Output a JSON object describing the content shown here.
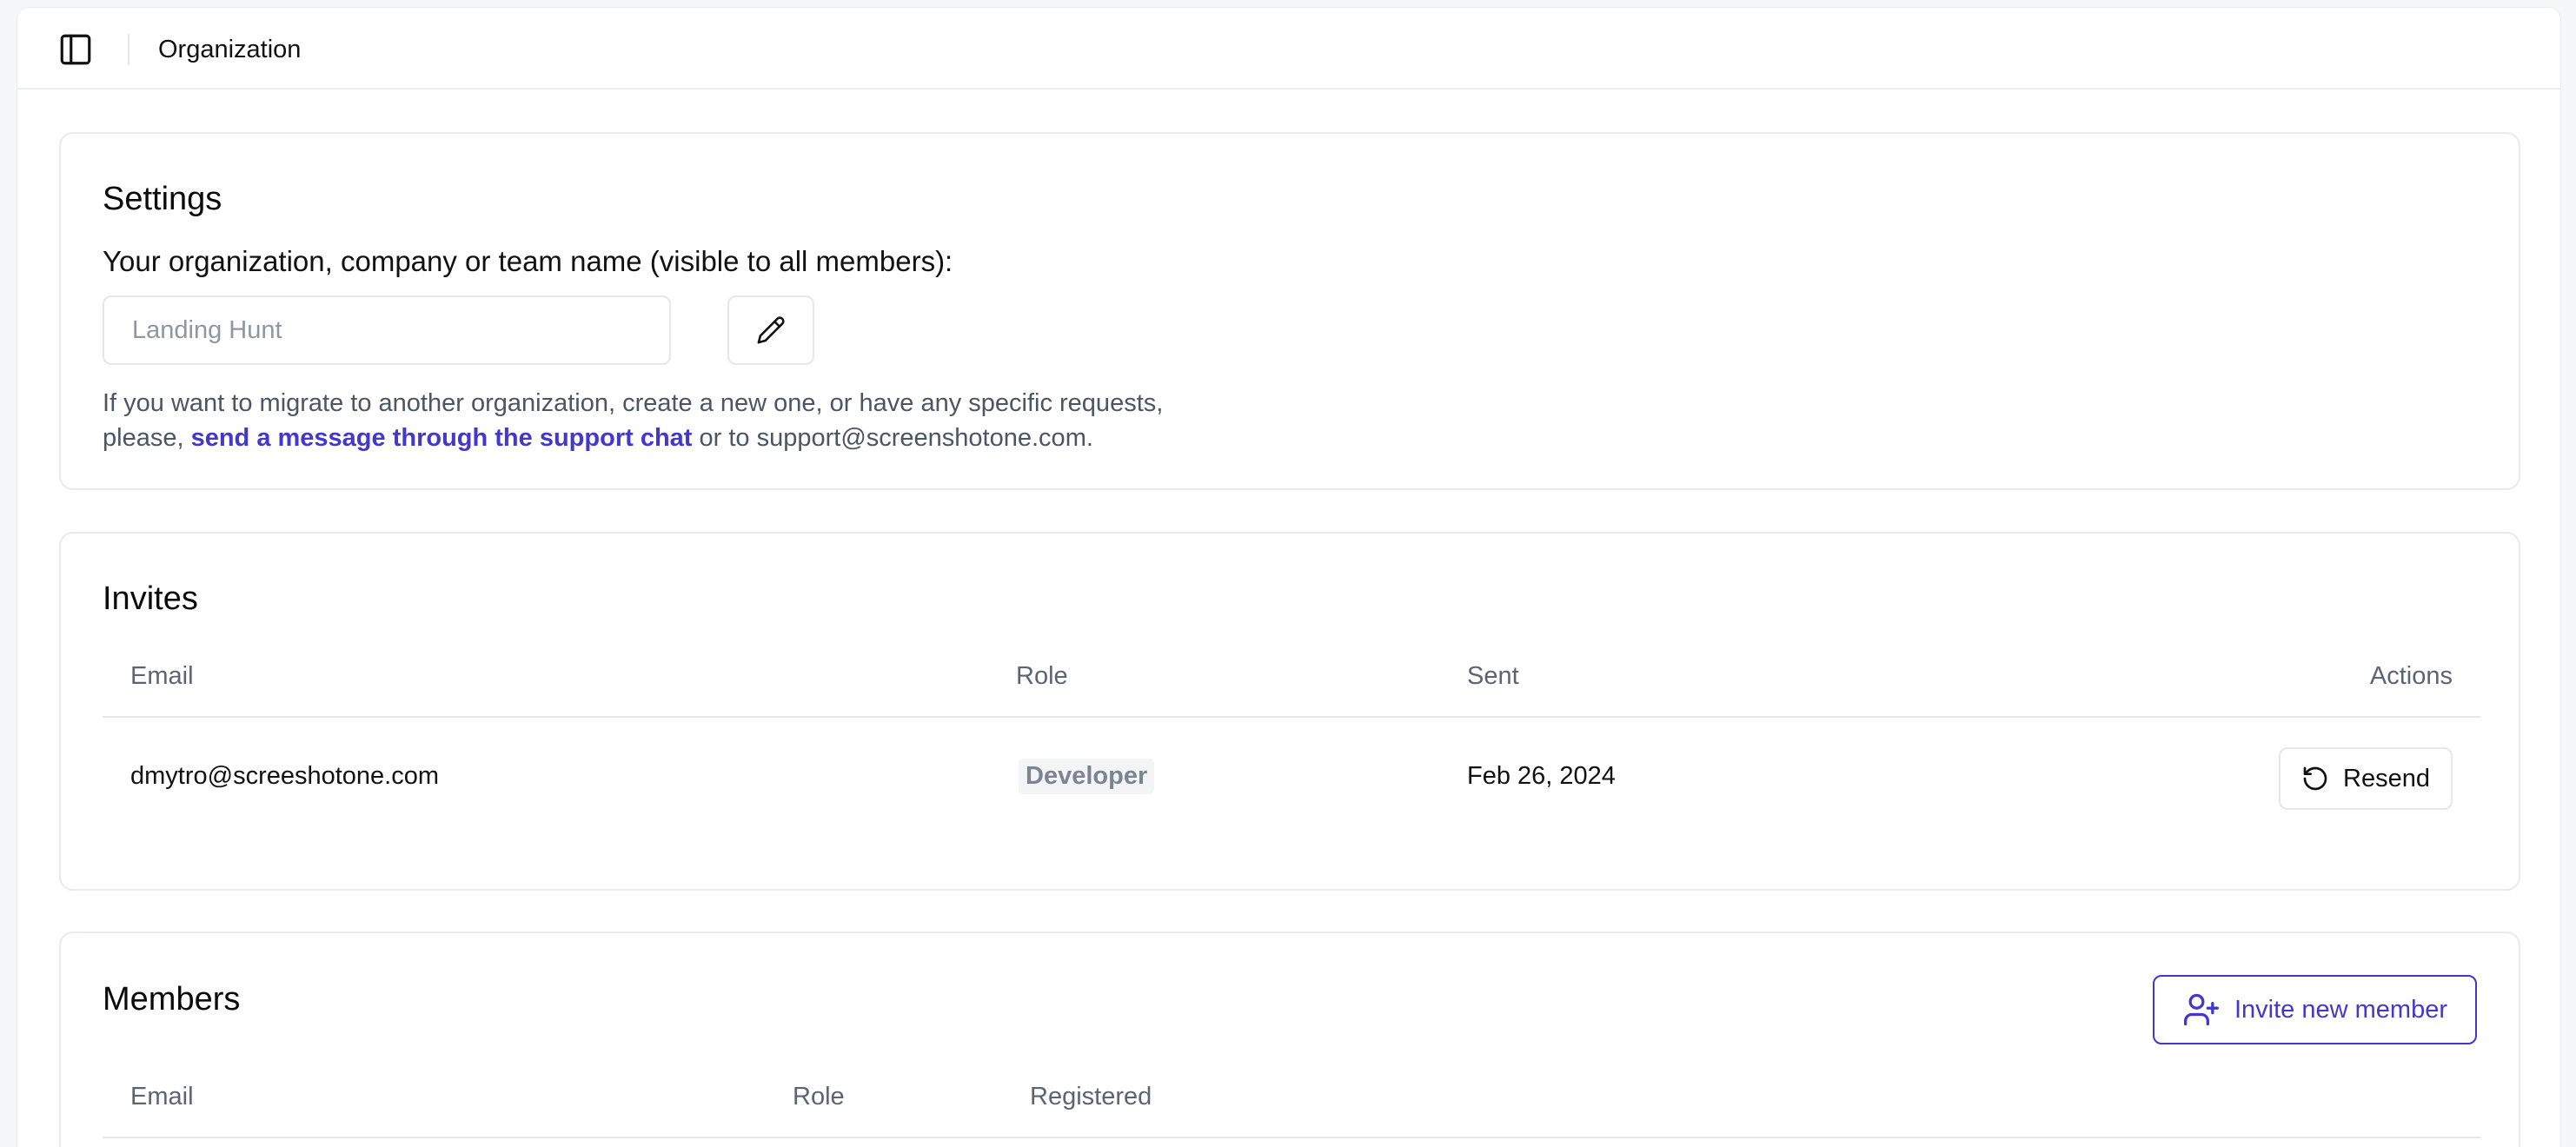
{
  "header": {
    "title": "Organization",
    "toggle_icon": "sidebar-toggle-icon"
  },
  "settings": {
    "title": "Settings",
    "label": "Your organization, company or team name (visible to all members):",
    "input_placeholder": "Landing Hunt",
    "edit_icon": "pencil-icon",
    "help_line1": "If you want to migrate to another organization, create a new one, or have any specific requests,",
    "help_prefix": "please, ",
    "help_link": "send a message through the support chat",
    "help_suffix": " or to support@screenshotone.com."
  },
  "invites": {
    "title": "Invites",
    "columns": {
      "email": "Email",
      "role": "Role",
      "sent": "Sent",
      "actions": "Actions"
    },
    "rows": [
      {
        "email": "dmytro@screeshotone.com",
        "role": "Developer",
        "sent": "Feb 26, 2024",
        "action_label": "Resend",
        "action_icon": "rotate-ccw-icon"
      }
    ]
  },
  "members": {
    "title": "Members",
    "invite_button_label": "Invite new member",
    "invite_button_icon": "user-plus-icon",
    "columns": {
      "email": "Email",
      "role": "Role",
      "registered": "Registered"
    }
  },
  "colors": {
    "accent": "#4338ca",
    "border": "#e5e7eb",
    "muted_text": "#5b6474"
  }
}
